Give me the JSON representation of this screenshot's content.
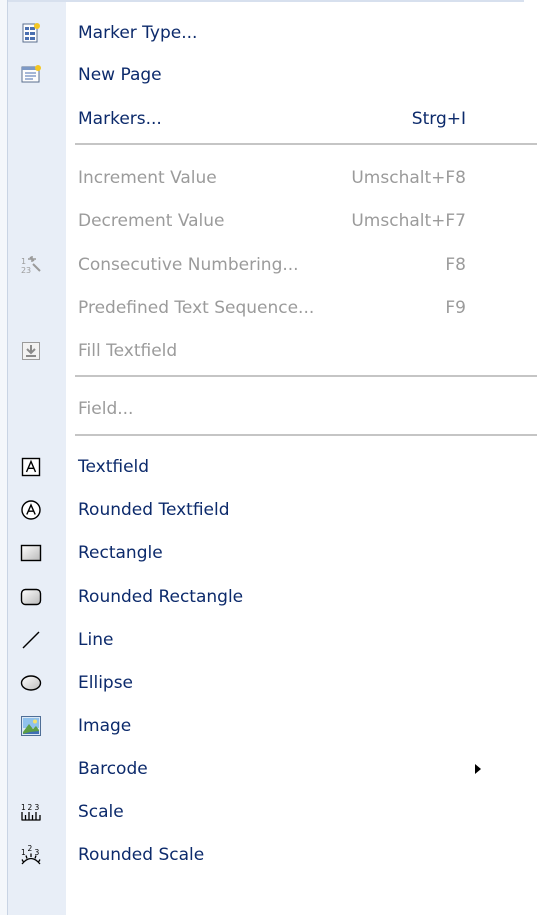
{
  "menu": {
    "marker_type": {
      "label": "Marker Type...",
      "icon": "marker-type-icon"
    },
    "new_page": {
      "label": "New Page",
      "icon": "new-page-icon"
    },
    "markers": {
      "label": "Markers...",
      "shortcut": "Strg+I"
    },
    "increment_value": {
      "label": "Increment Value",
      "shortcut": "Umschalt+F8",
      "enabled": false
    },
    "decrement_value": {
      "label": "Decrement Value",
      "shortcut": "Umschalt+F7",
      "enabled": false
    },
    "consecutive_numbering": {
      "label": "Consecutive Numbering...",
      "shortcut": "F8",
      "icon": "numbering-icon",
      "enabled": false
    },
    "predefined_text_sequence": {
      "label": "Predefined Text Sequence...",
      "shortcut": "F9",
      "enabled": false
    },
    "fill_textfield": {
      "label": "Fill Textfield",
      "icon": "fill-textfield-icon",
      "enabled": false
    },
    "field": {
      "label": "Field...",
      "enabled": false
    },
    "textfield": {
      "label": "Textfield",
      "icon": "textfield-icon"
    },
    "rounded_textfield": {
      "label": "Rounded Textfield",
      "icon": "rounded-textfield-icon"
    },
    "rectangle": {
      "label": "Rectangle",
      "icon": "rectangle-icon"
    },
    "rounded_rectangle": {
      "label": "Rounded Rectangle",
      "icon": "rounded-rectangle-icon"
    },
    "line": {
      "label": "Line",
      "icon": "line-icon"
    },
    "ellipse": {
      "label": "Ellipse",
      "icon": "ellipse-icon"
    },
    "image": {
      "label": "Image",
      "icon": "image-icon"
    },
    "barcode": {
      "label": "Barcode",
      "submenu": true
    },
    "scale": {
      "label": "Scale",
      "icon": "scale-icon"
    },
    "rounded_scale": {
      "label": "Rounded Scale",
      "icon": "rounded-scale-icon"
    }
  },
  "colors": {
    "enabled_text": "#0c2a6b",
    "disabled_text": "#9b9b9b",
    "gutter": "#e8eef7",
    "separator": "#c5c5c5"
  }
}
